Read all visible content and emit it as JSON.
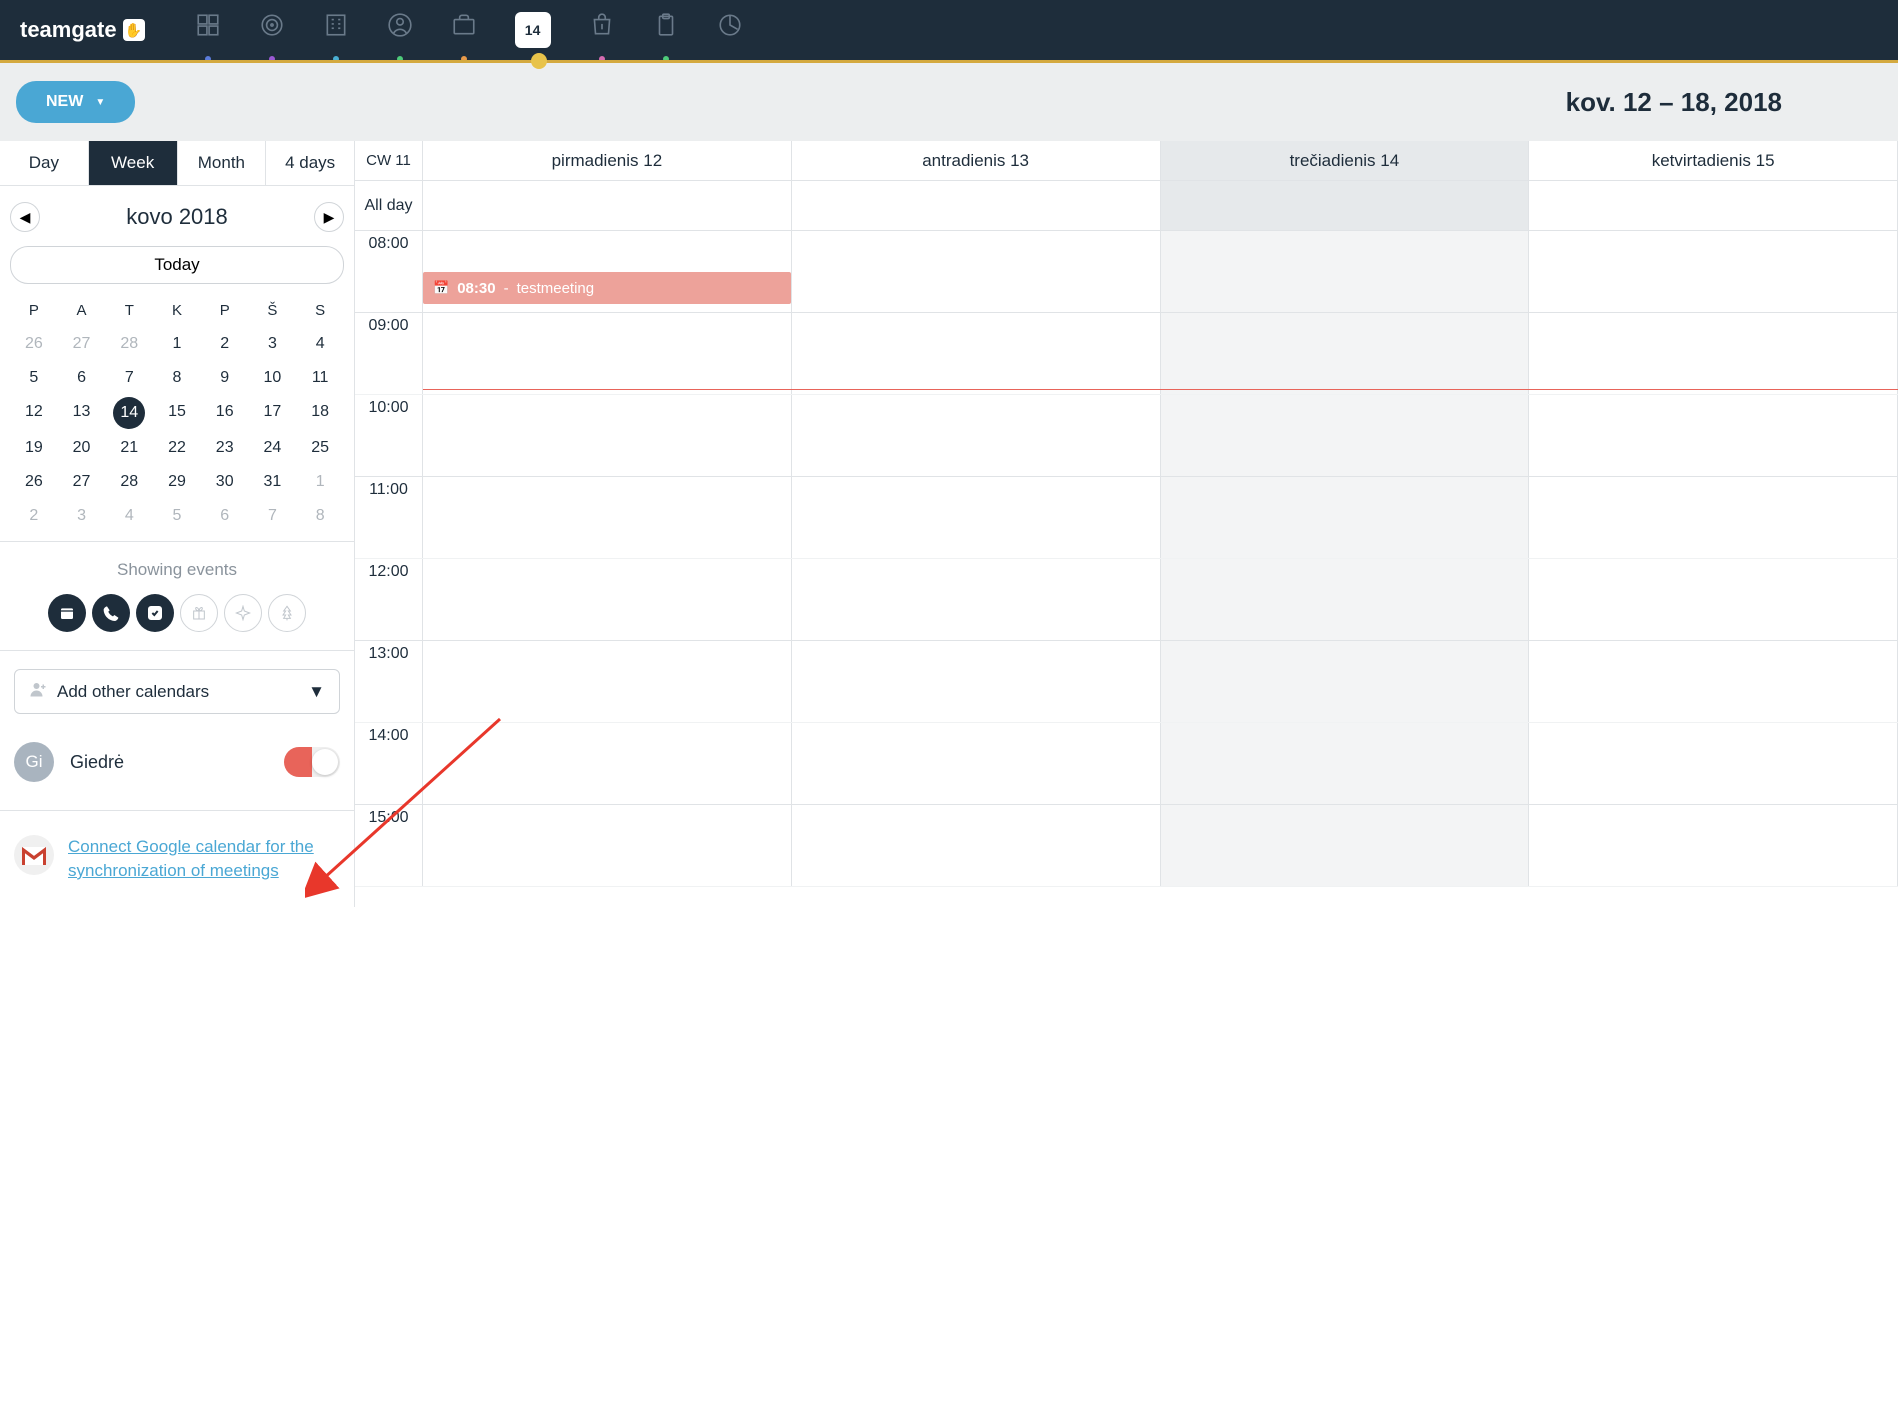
{
  "app": {
    "name": "teamgate"
  },
  "nav": {
    "active_index": 5,
    "calendar_day": "14"
  },
  "header": {
    "new_label": "NEW",
    "date_range": "kov. 12 – 18, 2018"
  },
  "views": {
    "items": [
      "Day",
      "Week",
      "Month",
      "4 days"
    ],
    "active": "Week"
  },
  "mini_cal": {
    "title": "kovo 2018",
    "today_label": "Today",
    "dow": [
      "P",
      "A",
      "T",
      "K",
      "P",
      "Š",
      "S"
    ],
    "weeks": [
      [
        {
          "d": "26",
          "m": true
        },
        {
          "d": "27",
          "m": true
        },
        {
          "d": "28",
          "m": true
        },
        {
          "d": "1"
        },
        {
          "d": "2"
        },
        {
          "d": "3"
        },
        {
          "d": "4"
        }
      ],
      [
        {
          "d": "5"
        },
        {
          "d": "6"
        },
        {
          "d": "7"
        },
        {
          "d": "8"
        },
        {
          "d": "9"
        },
        {
          "d": "10"
        },
        {
          "d": "11"
        }
      ],
      [
        {
          "d": "12"
        },
        {
          "d": "13"
        },
        {
          "d": "14",
          "sel": true
        },
        {
          "d": "15"
        },
        {
          "d": "16"
        },
        {
          "d": "17"
        },
        {
          "d": "18"
        }
      ],
      [
        {
          "d": "19"
        },
        {
          "d": "20"
        },
        {
          "d": "21"
        },
        {
          "d": "22"
        },
        {
          "d": "23"
        },
        {
          "d": "24"
        },
        {
          "d": "25"
        }
      ],
      [
        {
          "d": "26"
        },
        {
          "d": "27"
        },
        {
          "d": "28"
        },
        {
          "d": "29"
        },
        {
          "d": "30"
        },
        {
          "d": "31"
        },
        {
          "d": "1",
          "m": true
        }
      ],
      [
        {
          "d": "2",
          "m": true
        },
        {
          "d": "3",
          "m": true
        },
        {
          "d": "4",
          "m": true
        },
        {
          "d": "5",
          "m": true
        },
        {
          "d": "6",
          "m": true
        },
        {
          "d": "7",
          "m": true
        },
        {
          "d": "8",
          "m": true
        }
      ]
    ]
  },
  "filters": {
    "label": "Showing events",
    "add_calendars": "Add other calendars"
  },
  "user": {
    "initials": "Gi",
    "name": "Giedrė"
  },
  "google_link": "Connect Google calendar for the synchronization of meetings",
  "calendar": {
    "cw_label": "CW 11",
    "allday_label": "All day",
    "days": [
      {
        "label": "pirmadienis 12",
        "today": false
      },
      {
        "label": "antradienis 13",
        "today": false
      },
      {
        "label": "trečiadienis 14",
        "today": true
      },
      {
        "label": "ketvirtadienis 15",
        "today": false
      }
    ],
    "hours": [
      "08:00",
      "09:00",
      "10:00",
      "11:00",
      "12:00",
      "13:00",
      "14:00",
      "15:00"
    ],
    "event": {
      "time": "08:30",
      "title": "testmeeting",
      "day_index": 0
    }
  }
}
